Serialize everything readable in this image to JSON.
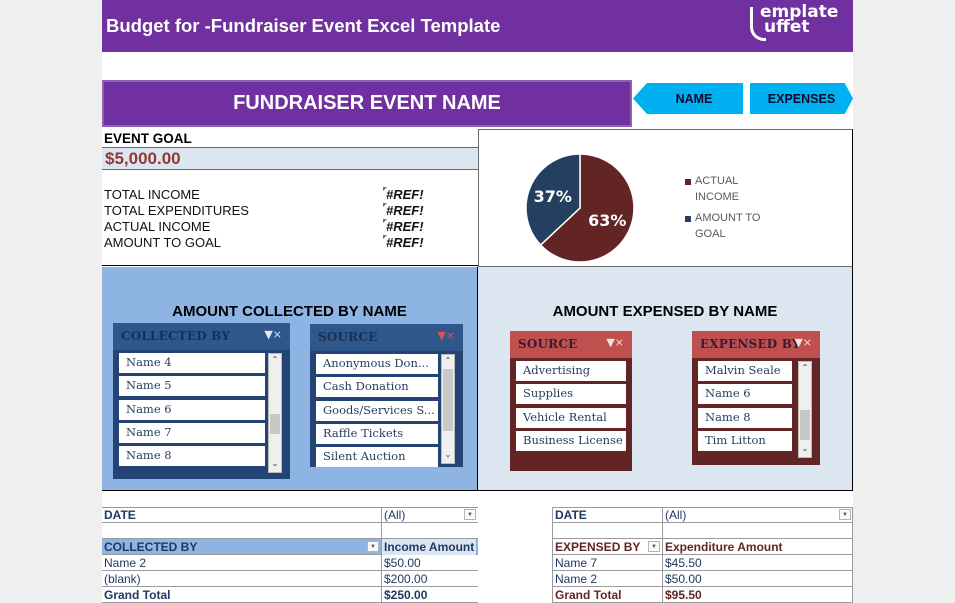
{
  "header": {
    "title": "Budget for -Fundraiser Event Excel Template",
    "logo": {
      "line1": "emplate",
      "line2": "uffet",
      "icon": "template-buffet-ladle-logo"
    }
  },
  "banner": {
    "event_name": "FUNDRAISER EVENT NAME"
  },
  "nav": {
    "name_button": "NAME",
    "expenses_button": "EXPENSES"
  },
  "goal": {
    "label": "EVENT GOAL",
    "value": "$5,000.00",
    "summary": [
      {
        "label": "TOTAL INCOME",
        "value": "#REF!"
      },
      {
        "label": "TOTAL EXPENDITURES",
        "value": "#REF!"
      },
      {
        "label": "ACTUAL INCOME",
        "value": "#REF!"
      },
      {
        "label": "AMOUNT TO GOAL",
        "value": "#REF!"
      }
    ]
  },
  "colors": {
    "brand_purple": "#7030a0",
    "nav_cyan": "#00b0f0",
    "actual_income": "#632523",
    "amount_to_goal": "#1f3864",
    "goal_value": "#953735"
  },
  "chart_data": {
    "type": "pie",
    "title": "",
    "slices": [
      {
        "label": "ACTUAL INCOME",
        "value": 63,
        "display": "63%",
        "color": "#632523"
      },
      {
        "label": "AMOUNT TO GOAL",
        "value": 37,
        "display": "37%",
        "color": "#243f60"
      }
    ],
    "legend": [
      "ACTUAL INCOME",
      "AMOUNT TO GOAL"
    ],
    "legend_position": "right"
  },
  "collected": {
    "title": "AMOUNT COLLECTED BY NAME",
    "collected_by_slicer": {
      "title": "COLLECTED BY",
      "items": [
        "Name 4",
        "Name 5",
        "Name 6",
        "Name 7",
        "Name 8"
      ]
    },
    "source_slicer": {
      "title": "SOURCE",
      "items": [
        "Anonymous Don...",
        "Cash Donation",
        "Goods/Services S...",
        "Raffle Tickets",
        "Silent Auction"
      ]
    }
  },
  "expensed": {
    "title": "AMOUNT EXPENSED BY NAME",
    "source_slicer": {
      "title": "SOURCE",
      "items": [
        "Advertising",
        "Supplies",
        "Vehicle Rental",
        "Business License"
      ]
    },
    "expensed_by_slicer": {
      "title": "EXPENSED BY",
      "items": [
        "Malvin Seale",
        "Name 6",
        "Name 8",
        "Tim Litton"
      ]
    }
  },
  "income_pivot": {
    "filter_label": "DATE",
    "filter_value": "(All)",
    "row_header": "COLLECTED BY",
    "value_header": "Income Amount",
    "rows": [
      {
        "name": "Name 2",
        "amount": "$50.00"
      },
      {
        "name": "(blank)",
        "amount": "$200.00"
      }
    ],
    "total_label": "Grand Total",
    "total_value": "$250.00"
  },
  "expense_pivot": {
    "filter_label": "DATE",
    "filter_value": "(All)",
    "row_header": "EXPENSED BY",
    "value_header": "Expenditure Amount",
    "rows": [
      {
        "name": "Name 7",
        "amount": "$45.50"
      },
      {
        "name": "Name 2",
        "amount": "$50.00"
      }
    ],
    "total_label": "Grand Total",
    "total_value": "$95.50"
  }
}
